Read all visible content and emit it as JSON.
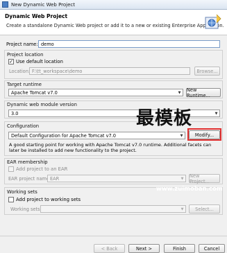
{
  "window": {
    "title": "New Dynamic Web Project"
  },
  "header": {
    "title": "Dynamic Web Project",
    "description": "Create a standalone Dynamic Web project or add it to a new or existing Enterprise Application."
  },
  "project_name": {
    "label": "Project name:",
    "value": "demo"
  },
  "project_location": {
    "section_label": "Project location",
    "use_default_label": "Use default location",
    "use_default_checked": true,
    "location_label": "Location:",
    "location_value": "F:\\tt_workspace\\demo",
    "browse_label": "Browse..."
  },
  "target_runtime": {
    "section_label": "Target runtime",
    "selected": "Apache Tomcat v7.0",
    "new_runtime_label": "New Runtime..."
  },
  "web_module": {
    "section_label": "Dynamic web module version",
    "selected": "3.0"
  },
  "configuration": {
    "section_label": "Configuration",
    "selected": "Default Configuration for Apache Tomcat v7.0",
    "modify_label": "Modify...",
    "description": "A good starting point for working with Apache Tomcat v7.0 runtime. Additional facets can later be installed to add new functionality to the project."
  },
  "ear": {
    "section_label": "EAR membership",
    "add_label": "Add project to an EAR",
    "project_name_label": "EAR project name:",
    "project_name_value": "EAR",
    "new_project_label": "New Project..."
  },
  "working_sets": {
    "section_label": "Working sets",
    "add_label": "Add project to working sets",
    "sets_label": "Working sets:",
    "select_label": "Select..."
  },
  "footer": {
    "back_label": "< Back",
    "next_label": "Next >",
    "finish_label": "Finish",
    "cancel_label": "Cancel"
  },
  "watermark": {
    "text": "最模板",
    "url": "www.zuimoban.com"
  },
  "colors": {
    "accent_border": "#7a9cc8",
    "highlight": "#e03030"
  }
}
